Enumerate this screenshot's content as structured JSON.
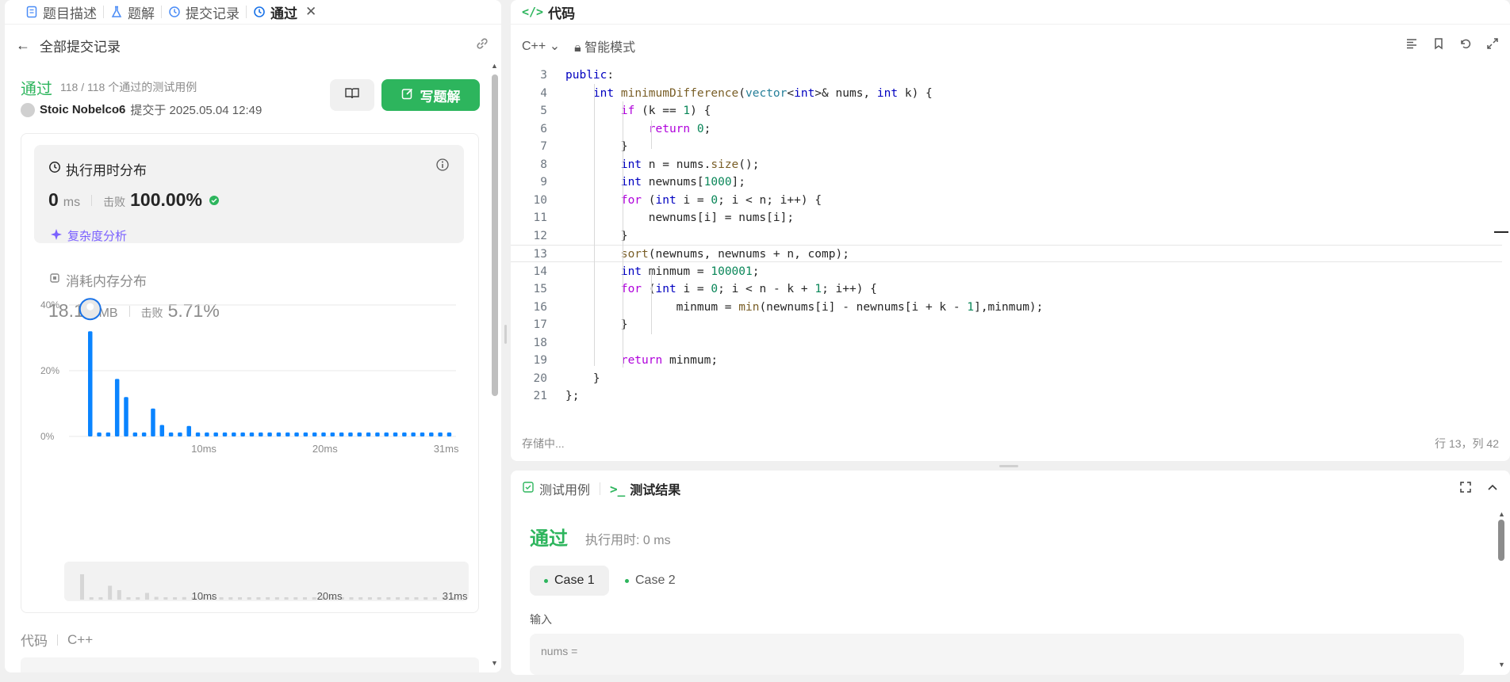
{
  "left_tabs": [
    {
      "label": "题目描述",
      "icon": "document-icon"
    },
    {
      "label": "题解",
      "icon": "flask-icon"
    },
    {
      "label": "提交记录",
      "icon": "history-icon"
    },
    {
      "label": "通过",
      "icon": "history-icon"
    }
  ],
  "back_label": "全部提交记录",
  "submission": {
    "status": "通过",
    "passed": "118 / 118 个通过的测试用例",
    "author": "Stoic Nobelco6",
    "submitted_at": "提交于 2025.05.04 12:49",
    "write_solution": "写题解"
  },
  "runtime": {
    "title": "执行用时分布",
    "value": "0",
    "unit": "ms",
    "beats_label": "击败",
    "beats": "100.00%",
    "complexity": "复杂度分析"
  },
  "memory": {
    "title": "消耗内存分布",
    "value": "18.10",
    "unit": "MB",
    "beats_label": "击败",
    "beats": "5.71%"
  },
  "chart_data": {
    "type": "bar",
    "ylabels": [
      "40%",
      "20%",
      "0%"
    ],
    "ylim": [
      0,
      40
    ],
    "xlabels": [
      "10ms",
      "20ms",
      "31ms"
    ],
    "values": [
      32,
      1.2,
      1.2,
      17.5,
      12,
      1.2,
      1.2,
      8.5,
      3.5,
      1.2,
      1.2,
      3.2,
      1.2,
      1.2,
      1.2,
      1.2,
      1.2,
      1.2,
      1.2,
      1.2,
      1.2,
      1.2,
      1.2,
      1.2,
      1.2,
      1.2,
      1.2,
      1.2,
      1.2,
      1.2,
      1.2,
      1.2,
      1.2,
      1.2,
      1.2,
      1.2,
      1.2,
      1.2,
      1.2,
      1.2,
      1.2
    ],
    "bar_color": "#0a84ff",
    "grid": true
  },
  "code_section": {
    "label": "代码",
    "lang": "C++"
  },
  "editor": {
    "title": "代码",
    "language": "C++",
    "mode": "智能模式",
    "status": "存储中...",
    "position": "行 13，列 42",
    "current_line": 13,
    "lines": [
      {
        "n": 3,
        "text": "public:"
      },
      {
        "n": 4,
        "text": "    int minimumDifference(vector<int>& nums, int k) {"
      },
      {
        "n": 5,
        "text": "        if (k == 1) {"
      },
      {
        "n": 6,
        "text": "            return 0;"
      },
      {
        "n": 7,
        "text": "        }"
      },
      {
        "n": 8,
        "text": "        int n = nums.size();"
      },
      {
        "n": 9,
        "text": "        int newnums[1000];"
      },
      {
        "n": 10,
        "text": "        for (int i = 0; i < n; i++) {"
      },
      {
        "n": 11,
        "text": "            newnums[i] = nums[i];"
      },
      {
        "n": 12,
        "text": "        }"
      },
      {
        "n": 13,
        "text": "        sort(newnums, newnums + n, comp);"
      },
      {
        "n": 14,
        "text": "        int minmum = 100001;"
      },
      {
        "n": 15,
        "text": "        for (int i = 0; i < n - k + 1; i++) {"
      },
      {
        "n": 16,
        "text": "                minmum = min(newnums[i] - newnums[i + k - 1],minmum);"
      },
      {
        "n": 17,
        "text": "        }"
      },
      {
        "n": 18,
        "text": ""
      },
      {
        "n": 19,
        "text": "        return minmum;"
      },
      {
        "n": 20,
        "text": "    }"
      },
      {
        "n": 21,
        "text": "};"
      }
    ]
  },
  "tests": {
    "tab_cases": "测试用例",
    "tab_results": "测试结果",
    "status": "通过",
    "runtime": "执行用时: 0 ms",
    "cases": [
      "Case 1",
      "Case 2"
    ],
    "input_label": "输入",
    "input_first": "nums ="
  },
  "colors": {
    "accent_green": "#2db55d",
    "bar_blue": "#0a84ff",
    "complexity_purple": "#7b61ff"
  }
}
